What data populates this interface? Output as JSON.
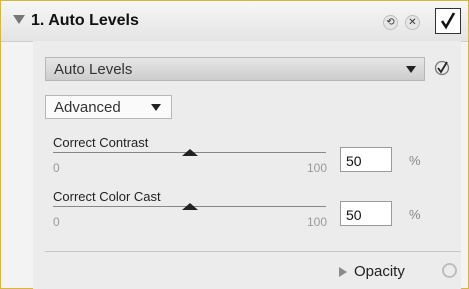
{
  "panel": {
    "title": "1. Auto Levels",
    "header_icons": [
      "undo-icon",
      "close-icon"
    ],
    "enabled": true
  },
  "method_select": {
    "value": "Auto Levels"
  },
  "mode_select": {
    "value": "Advanced"
  },
  "sliders": [
    {
      "label": "Correct Contrast",
      "min": "0",
      "max": "100",
      "value": "50",
      "unit": "%"
    },
    {
      "label": "Correct Color Cast",
      "min": "0",
      "max": "100",
      "value": "50",
      "unit": "%"
    }
  ],
  "opacity": {
    "label": "Opacity"
  },
  "colors": {
    "border": "#d6b73a"
  }
}
